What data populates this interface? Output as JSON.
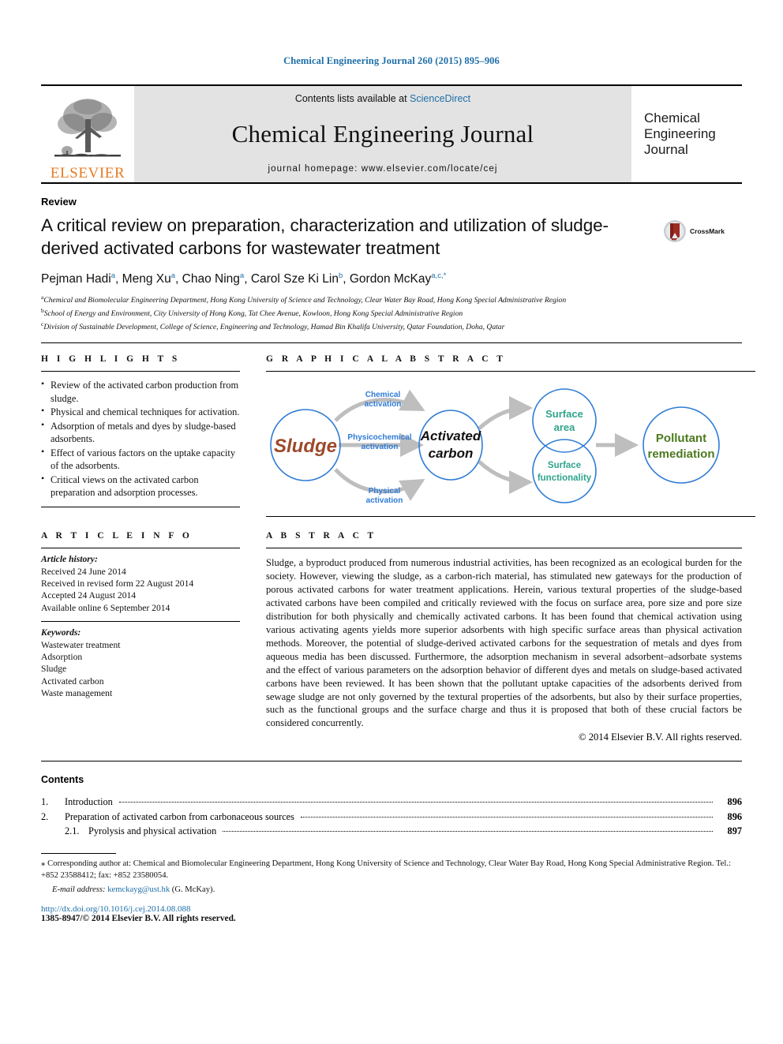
{
  "running_head": "Chemical Engineering Journal 260 (2015) 895–906",
  "masthead": {
    "contents_prefix": "Contents lists available at ",
    "sciencedirect": "ScienceDirect",
    "journal_title": "Chemical Engineering Journal",
    "homepage": "journal homepage: www.elsevier.com/locate/cej",
    "publisher": "ELSEVIER",
    "cover_lines": [
      "Chemical",
      "Engineering",
      "Journal"
    ],
    "header_bg": "#e3e3e3",
    "publisher_color": "#E87B22",
    "link_color": "#1f6fa8"
  },
  "article": {
    "kind": "Review",
    "title": "A critical review on preparation, characterization and utilization of sludge-derived activated carbons for wastewater treatment",
    "crossmark_label": "CrossMark",
    "authors": [
      {
        "name": "Pejman Hadi",
        "sup": "a",
        "sep": ", "
      },
      {
        "name": "Meng Xu",
        "sup": "a",
        "sep": ", "
      },
      {
        "name": "Chao Ning",
        "sup": "a",
        "sep": ", "
      },
      {
        "name": "Carol Sze Ki Lin",
        "sup": "b",
        "sep": ", "
      },
      {
        "name": "Gordon McKay",
        "sup": "a,c,*",
        "sep": ""
      }
    ],
    "affiliations": [
      {
        "mark": "a",
        "text": "Chemical and Biomolecular Engineering Department, Hong Kong University of Science and Technology, Clear Water Bay Road, Hong Kong Special Administrative Region"
      },
      {
        "mark": "b",
        "text": "School of Energy and Environment, City University of Hong Kong, Tat Chee Avenue, Kowloon, Hong Kong Special Administrative Region"
      },
      {
        "mark": "c",
        "text": "Division of Sustainable Development, College of Science, Engineering and Technology, Hamad Bin Khalifa University, Qatar Foundation, Doha, Qatar"
      }
    ]
  },
  "highlights": {
    "heading": "H I G H L I G H T S",
    "items": [
      "Review of the activated carbon production from sludge.",
      "Physical and chemical techniques for activation.",
      "Adsorption of metals and dyes by sludge-based adsorbents.",
      "Effect of various factors on the uptake capacity of the adsorbents.",
      "Critical views on the activated carbon preparation and adsorption processes."
    ]
  },
  "graphical_abstract": {
    "heading": "G R A P H I C A L   A B S T R A C T",
    "nodes": [
      {
        "id": "sludge",
        "label": "Sludge",
        "color": "#9C4A2B"
      },
      {
        "id": "activated-carbon",
        "label_line1": "Activated",
        "label_line2": "carbon",
        "color": "#111111"
      },
      {
        "id": "surface-area",
        "label_line1": "Surface",
        "label_line2": "area",
        "color": "#2FA48C"
      },
      {
        "id": "surface-functionality",
        "label_line1": "Surface",
        "label_line2": "functionality",
        "color": "#2FA48C"
      },
      {
        "id": "pollutant-remediation",
        "label_line1": "Pollutant",
        "label_line2": "remediation",
        "color": "#4C7A1E"
      }
    ],
    "edge_labels": [
      {
        "id": "chemical",
        "line1": "Chemical",
        "line2": "activation",
        "color": "#2F7CD6"
      },
      {
        "id": "physicochemical",
        "line1": "Physicochemical",
        "line2": "activation",
        "color": "#2F7CD6"
      },
      {
        "id": "physical",
        "line1": "Physical",
        "line2": "activation",
        "color": "#2F7CD6"
      }
    ],
    "circle_stroke": "#2F7CD6",
    "arrow_color": "#BEBEBE"
  },
  "article_info": {
    "heading": "A R T I C L E   I N F O",
    "history_label": "Article history:",
    "history": [
      "Received 24 June 2014",
      "Received in revised form 22 August 2014",
      "Accepted 24 August 2014",
      "Available online 6 September 2014"
    ],
    "keywords_label": "Keywords:",
    "keywords": [
      "Wastewater treatment",
      "Adsorption",
      "Sludge",
      "Activated carbon",
      "Waste management"
    ]
  },
  "abstract": {
    "heading": "A B S T R A C T",
    "text": "Sludge, a byproduct produced from numerous industrial activities, has been recognized as an ecological burden for the society. However, viewing the sludge, as a carbon-rich material, has stimulated new gateways for the production of porous activated carbons for water treatment applications. Herein, various textural properties of the sludge-based activated carbons have been compiled and critically reviewed with the focus on surface area, pore size and pore size distribution for both physically and chemically activated carbons. It has been found that chemical activation using various activating agents yields more superior adsorbents with high specific surface areas than physical activation methods. Moreover, the potential of sludge-derived activated carbons for the sequestration of metals and dyes from aqueous media has been discussed. Furthermore, the adsorption mechanism in several adsorbent–adsorbate systems and the effect of various parameters on the adsorption behavior of different dyes and metals on sludge-based activated carbons have been reviewed. It has been shown that the pollutant uptake capacities of the adsorbents derived from sewage sludge are not only governed by the textural properties of the adsorbents, but also by their surface properties, such as the functional groups and the surface charge and thus it is proposed that both of these crucial factors be considered concurrently.",
    "copyright": "© 2014 Elsevier B.V. All rights reserved."
  },
  "contents": {
    "title": "Contents",
    "entries": [
      {
        "num": "1.",
        "label": "Introduction",
        "page": "896",
        "sub": false
      },
      {
        "num": "2.",
        "label": "Preparation of activated carbon from carbonaceous sources",
        "page": "896",
        "sub": false
      },
      {
        "num": "2.1.",
        "label": "Pyrolysis and physical activation",
        "page": "897",
        "sub": true
      }
    ]
  },
  "footer": {
    "corresponding_star": "⁎",
    "corresponding": "Corresponding author at: Chemical and Biomolecular Engineering Department, Hong Kong University of Science and Technology, Clear Water Bay Road, Hong Kong Special Administrative Region. Tel.: +852 23588412; fax: +852 23580054.",
    "email_label": "E-mail address:",
    "email": "kemckayg@ust.hk",
    "email_owner": "(G. McKay).",
    "doi": "http://dx.doi.org/10.1016/j.cej.2014.08.088",
    "issn_line": "1385-8947/© 2014 Elsevier B.V. All rights reserved."
  }
}
